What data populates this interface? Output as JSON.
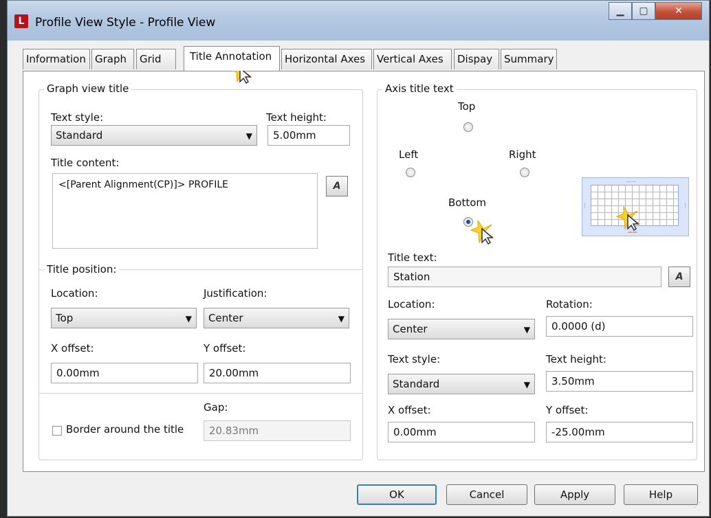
{
  "window": {
    "title": "Profile View Style - Profile View",
    "app_icon": "L"
  },
  "tabs": [
    "Information",
    "Graph",
    "Grid",
    "Title Annotation",
    "Horizontal Axes",
    "Vertical Axes",
    "Dispay",
    "Summary"
  ],
  "active_tab": "Title Annotation",
  "graph_view_title": {
    "legend": "Graph view title",
    "text_style_label": "Text style:",
    "text_style_value": "Standard",
    "text_height_label": "Text height:",
    "text_height_value": "5.00mm",
    "title_content_label": "Title content:",
    "title_content_value": "<[Parent Alignment(CP)]> PROFILE"
  },
  "title_position": {
    "legend": "Title position:",
    "location_label": "Location:",
    "location_value": "Top",
    "justification_label": "Justification:",
    "justification_value": "Center",
    "x_offset_label": "X offset:",
    "x_offset_value": "0.00mm",
    "y_offset_label": "Y offset:",
    "y_offset_value": "20.00mm",
    "gap_label": "Gap:",
    "gap_value": "20.83mm",
    "border_label": "Border around the title",
    "border_checked": false
  },
  "axis_title_text": {
    "legend": "Axis title text",
    "top_label": "Top",
    "left_label": "Left",
    "right_label": "Right",
    "bottom_label": "Bottom",
    "selected_position": "Bottom",
    "title_text_label": "Title text:",
    "title_text_value": "Station",
    "location_label": "Location:",
    "location_value": "Center",
    "rotation_label": "Rotation:",
    "rotation_value": "0.0000 (d)",
    "text_style_label": "Text style:",
    "text_style_value": "Standard",
    "text_height_label": "Text height:",
    "text_height_value": "3.50mm",
    "x_offset_label": "X offset:",
    "x_offset_value": "0.00mm",
    "y_offset_label": "Y offset:",
    "y_offset_value": "-25.00mm"
  },
  "buttons": {
    "ok": "OK",
    "cancel": "Cancel",
    "apply": "Apply",
    "help": "Help"
  },
  "colors": {
    "accent": "#3c7fb1",
    "preview_fill": "#dbe6fb",
    "preview_highlight": "#d44a1f"
  }
}
